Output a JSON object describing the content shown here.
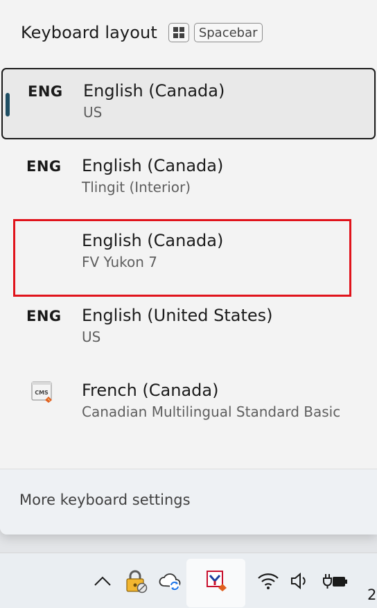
{
  "header": {
    "title": "Keyboard layout",
    "shortcut_win_key": "windows-key",
    "shortcut_space_label": "Spacebar"
  },
  "layouts": [
    {
      "code": "ENG",
      "language": "English (Canada)",
      "layout": "US",
      "selected": true
    },
    {
      "code": "ENG",
      "language": "English (Canada)",
      "layout": "Tlingit (Interior)",
      "selected": false
    },
    {
      "code": "",
      "language": "English (Canada)",
      "layout": "FV Yukon 7",
      "selected": false,
      "highlighted": true
    },
    {
      "code": "ENG",
      "language": "English (United States)",
      "layout": "US",
      "selected": false
    },
    {
      "code": "",
      "icon": "cms-keyboard-icon",
      "language": "French (Canada)",
      "layout": "Canadian Multilingual Standard Basic",
      "selected": false
    }
  ],
  "footer": {
    "link": "More keyboard settings"
  },
  "taskbar": {
    "icons": [
      "show-hidden-icons-chevron",
      "vpn-lock-icon",
      "onedrive-sync-icon",
      "input-method-icon",
      "wifi-icon",
      "volume-icon",
      "battery-charging-icon"
    ],
    "clock_fragment": "2"
  },
  "colors": {
    "highlight_box": "#e0131b",
    "selection_indicator": "#1f4e63"
  }
}
